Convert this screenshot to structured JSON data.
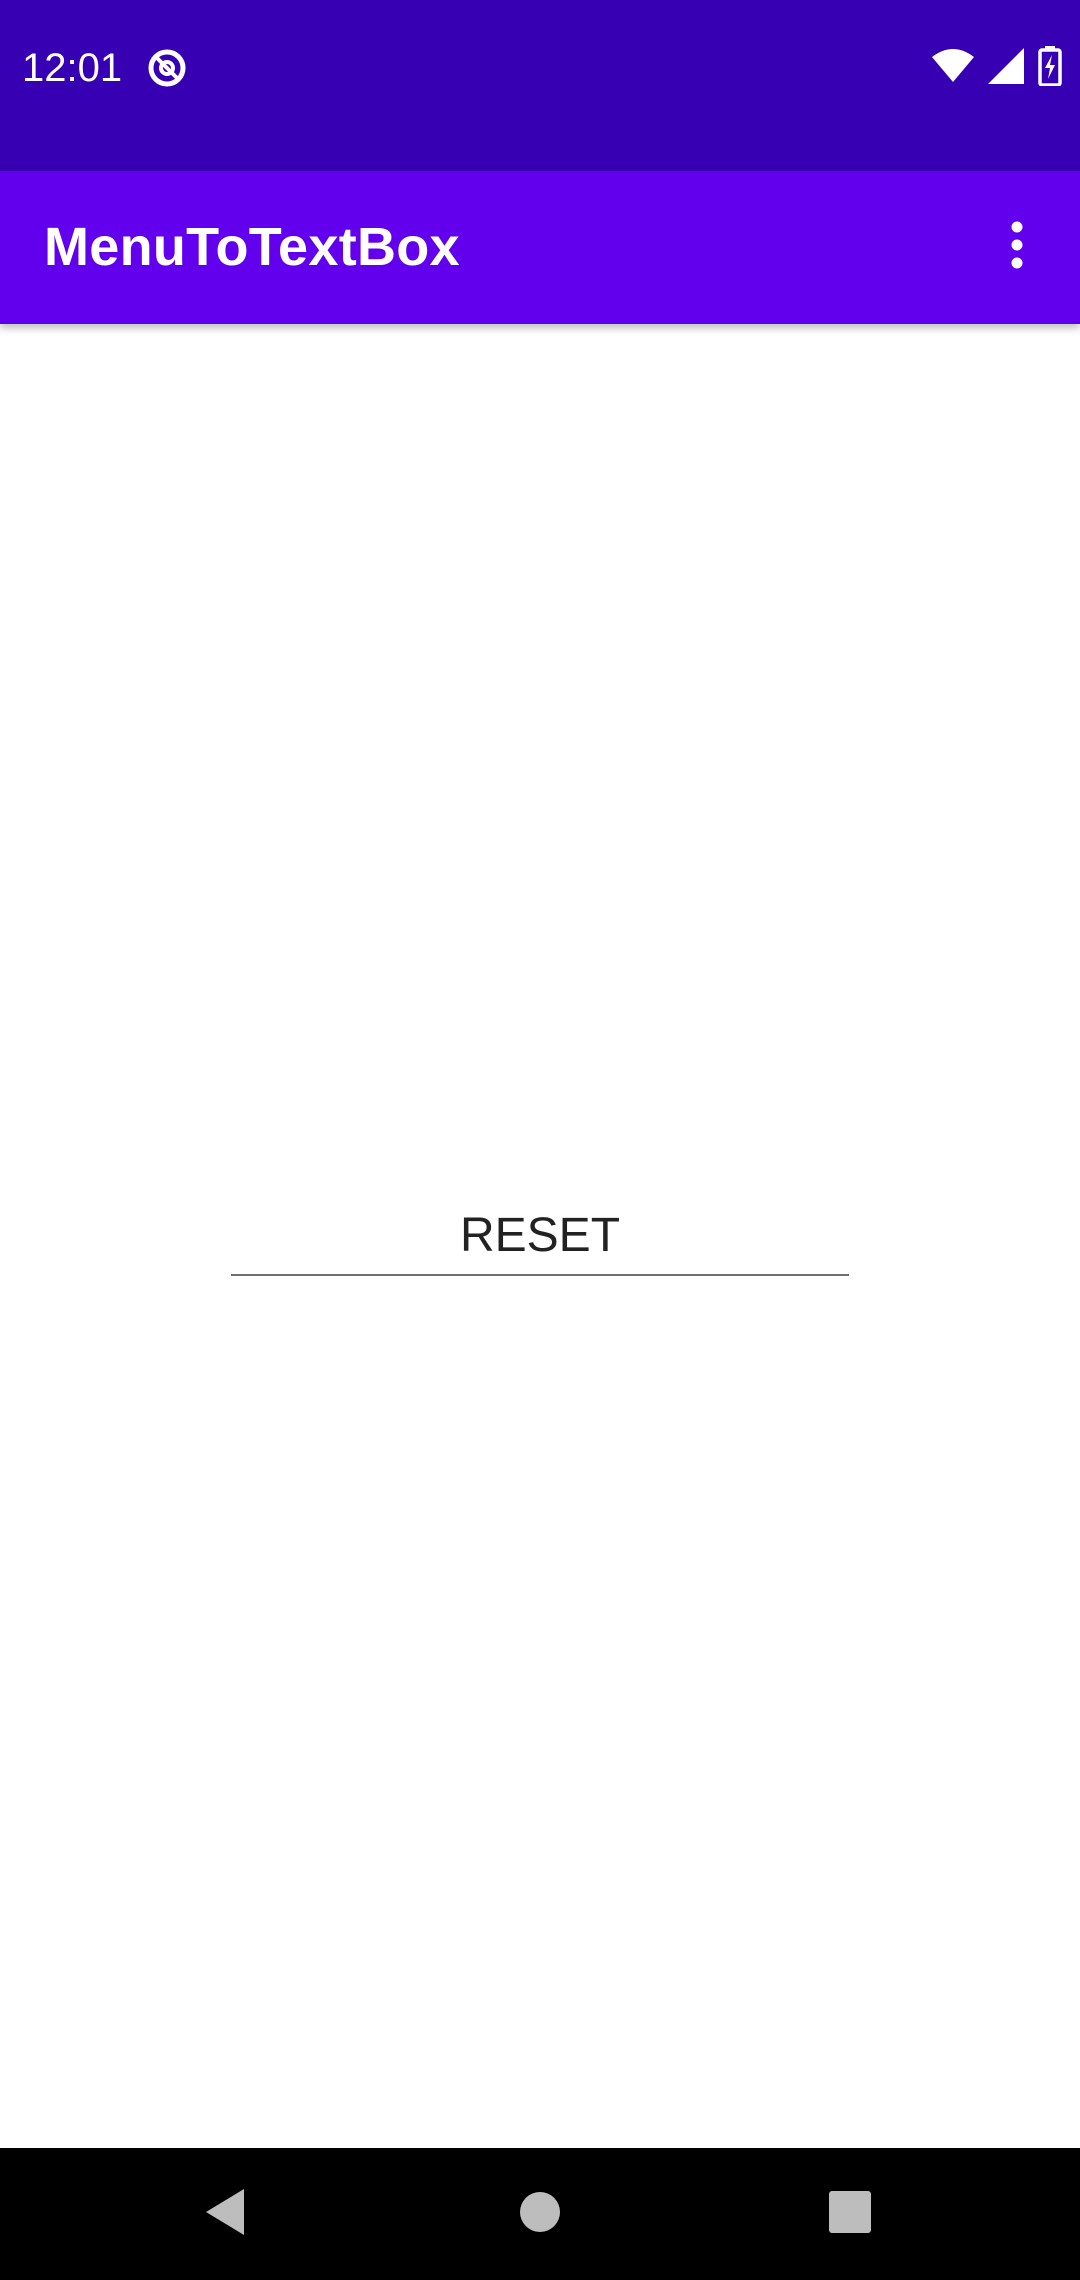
{
  "status_bar": {
    "time": "12:01",
    "notification_icon": "at-sign-notification-icon",
    "icons": [
      "wifi-icon",
      "cellular-signal-icon",
      "battery-charging-icon"
    ],
    "background": "#3700B3"
  },
  "app_bar": {
    "title": "MenuToTextBox",
    "overflow_icon": "more-vert-icon",
    "background": "#6200EE"
  },
  "main": {
    "text_box": {
      "value": "RESET"
    }
  },
  "nav_bar": {
    "buttons": [
      "back-icon",
      "home-icon",
      "recents-icon"
    ]
  }
}
